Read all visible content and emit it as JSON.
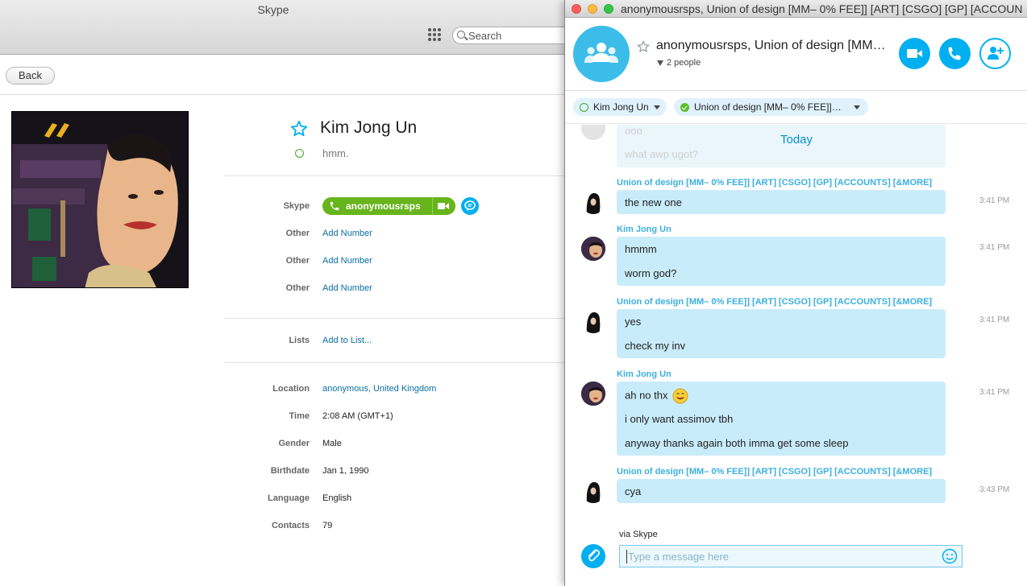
{
  "main_window": {
    "title": "Skype",
    "search_placeholder": "Search",
    "back_label": "Back",
    "profile": {
      "name": "Kim Jong Un",
      "mood": "hmm.",
      "fields": [
        {
          "label": "Skype",
          "value": "anonymousrsps"
        },
        {
          "label": "Other",
          "value": "Add Number"
        },
        {
          "label": "Other",
          "value": "Add Number"
        },
        {
          "label": "Other",
          "value": "Add Number"
        },
        {
          "label": "Lists",
          "value": "Add to List..."
        },
        {
          "label": "Location",
          "value": "anonymous, United Kingdom"
        },
        {
          "label": "Time",
          "value": "2:08 AM (GMT+1)"
        },
        {
          "label": "Gender",
          "value": "Male"
        },
        {
          "label": "Birthdate",
          "value": "Jan 1, 1990"
        },
        {
          "label": "Language",
          "value": "English"
        },
        {
          "label": "Contacts",
          "value": "79"
        }
      ]
    }
  },
  "conversation": {
    "window_title": "anonymousrsps, Union of design [MM– 0% FEE]] [ART] [CSGO] [GP] [ACCOUN…",
    "header_name": "anonymousrsps, Union of design [MM…",
    "people_count": "2 people",
    "participants": [
      {
        "name": "Kim Jong Un",
        "status": "offline"
      },
      {
        "name": "Union of design [MM– 0% FEE]]…",
        "status": "online"
      }
    ],
    "faded_lines": [
      "ooo",
      "what awp ugot?"
    ],
    "today_label": "Today",
    "messages": [
      {
        "author": "Union of design [MM– 0% FEE]] [ART] [CSGO] [GP] [ACCOUNTS] [&MORE]",
        "time": "3:41 PM",
        "lines": [
          "the new one"
        ]
      },
      {
        "author": "Kim Jong Un",
        "time": "3:41 PM",
        "lines": [
          "hmmm",
          "worm god?"
        ]
      },
      {
        "author": "Union of design [MM– 0% FEE]] [ART] [CSGO] [GP] [ACCOUNTS] [&MORE]",
        "time": "3:41 PM",
        "lines": [
          "yes",
          "check my inv"
        ]
      },
      {
        "author": "Kim Jong Un",
        "time": "3:41 PM",
        "lines": [
          "ah no thx",
          "i only want assimov tbh",
          "anyway thanks again both imma get some sleep"
        ]
      },
      {
        "author": "Union of design [MM– 0% FEE]] [ART] [CSGO] [GP] [ACCOUNTS] [&MORE]",
        "time": "3:43 PM",
        "lines": [
          "cya"
        ]
      }
    ],
    "via_label": "via Skype",
    "input_placeholder": "Type a message here"
  },
  "colors": {
    "skype_blue": "#00aff0",
    "bubble": "#c9ecfb",
    "online_green": "#5cbf2a",
    "pill_green": "#67b41d"
  },
  "icons": [
    "dialpad-icon",
    "search-icon",
    "star-icon",
    "phone-icon",
    "video-icon",
    "chat-icon",
    "group-icon",
    "add-person-icon",
    "paperclip-icon",
    "emoji-icon"
  ]
}
